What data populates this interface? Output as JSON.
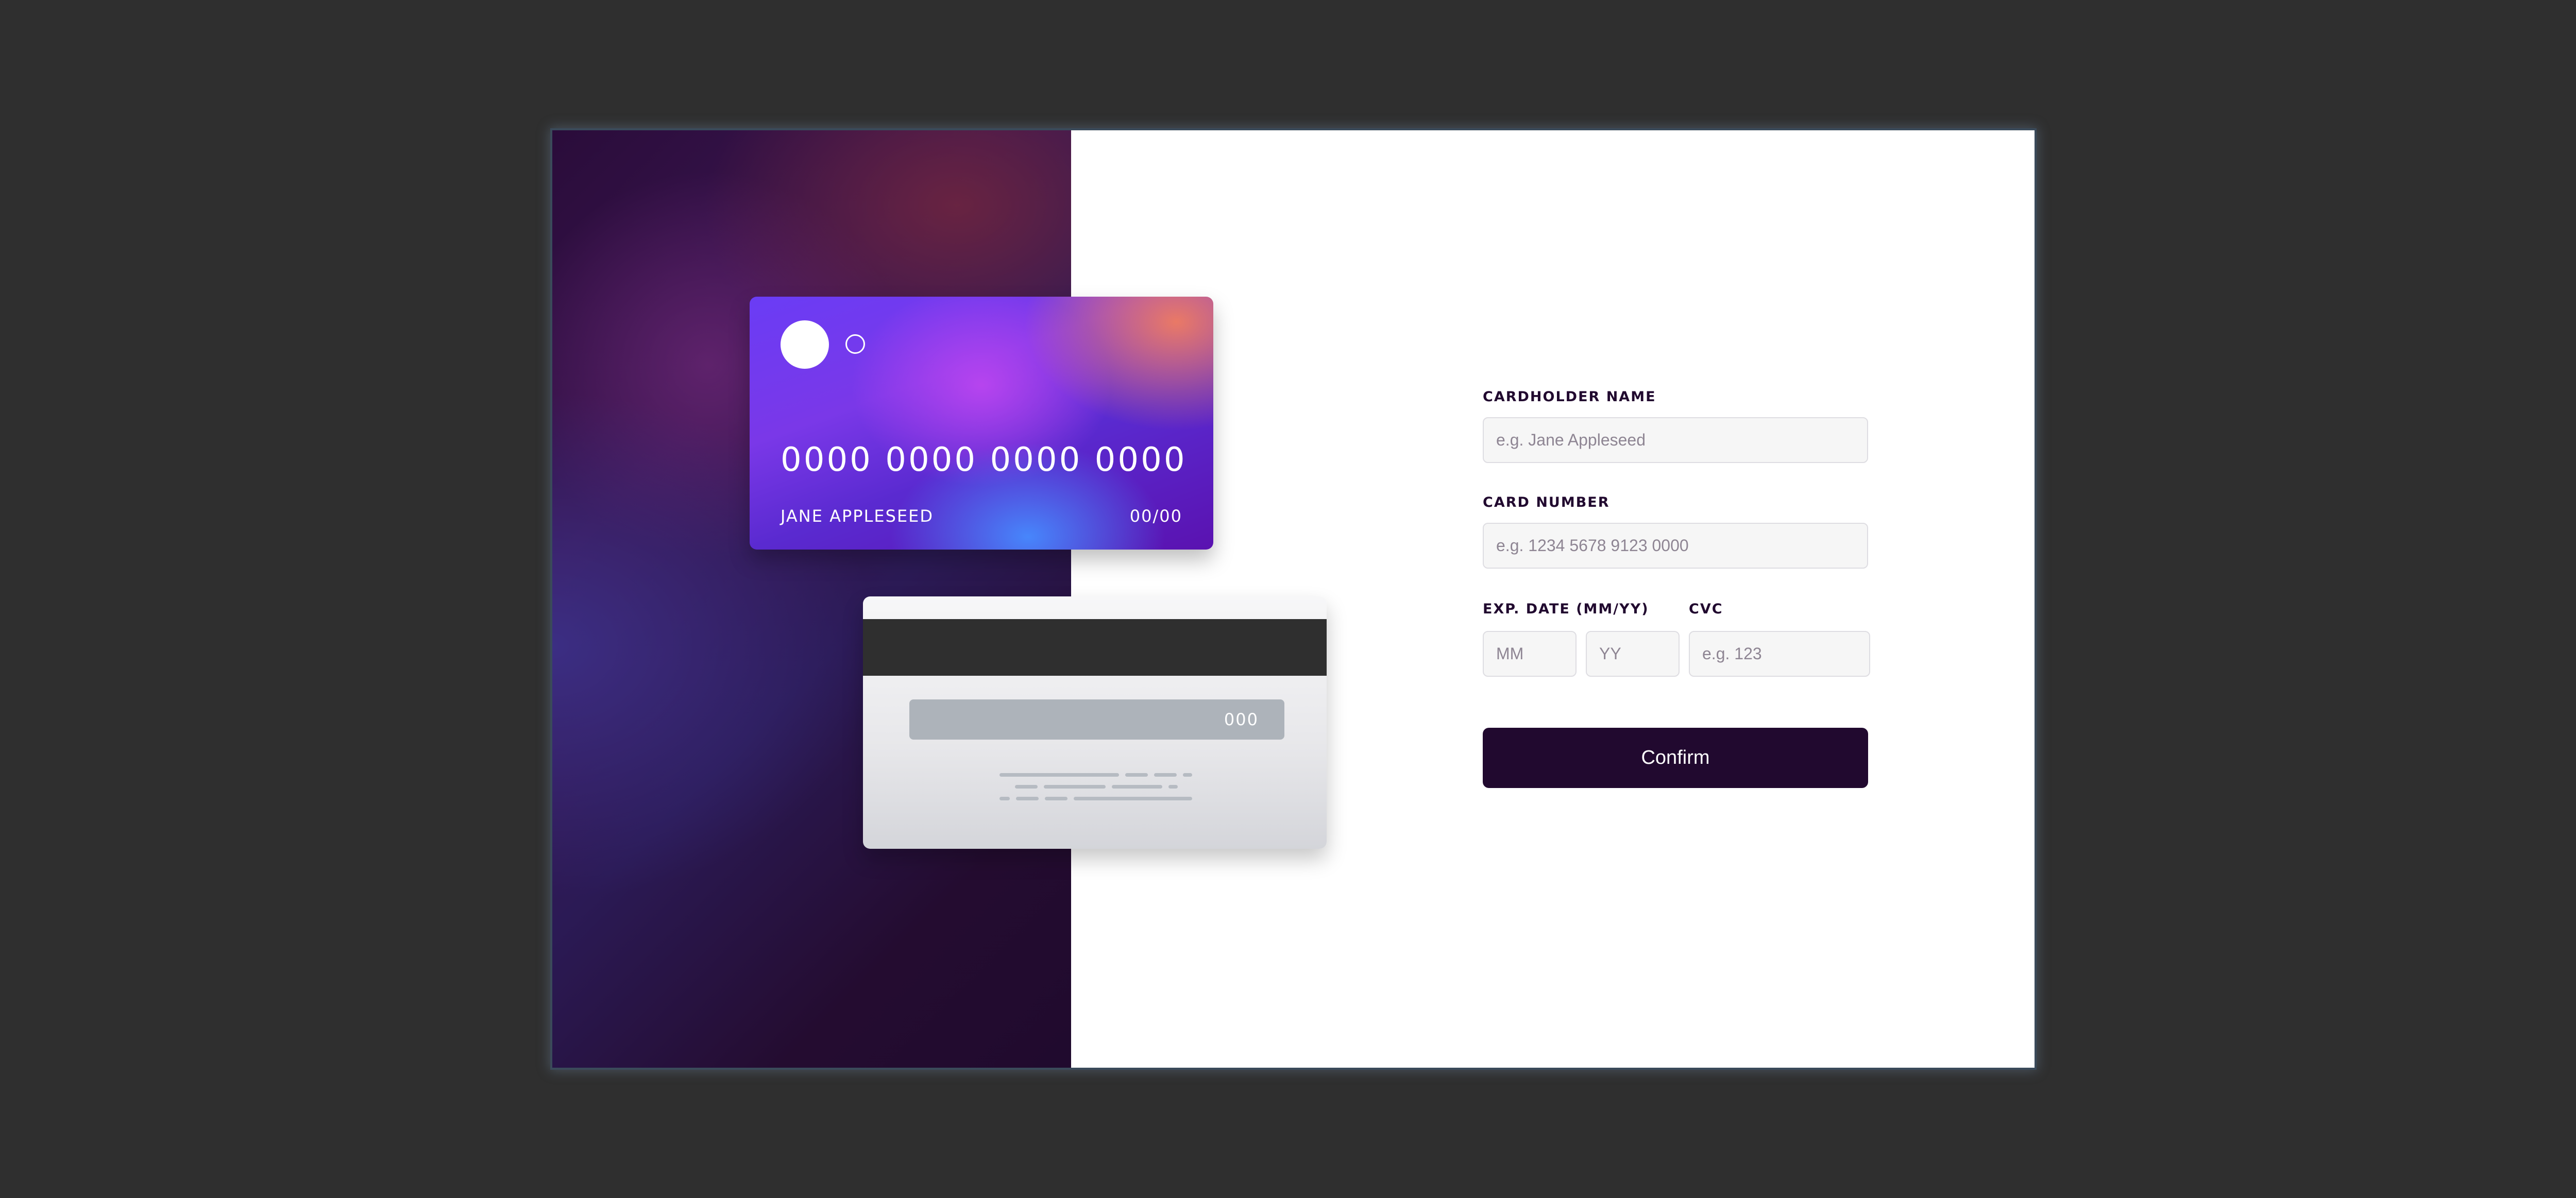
{
  "card_front": {
    "number": "0000 0000 0000 0000",
    "name": "JANE APPLESEED",
    "expiry": "00/00"
  },
  "card_back": {
    "cvc": "000"
  },
  "form": {
    "cardholder_name": {
      "label": "CARDHOLDER NAME",
      "placeholder": "e.g. Jane Appleseed",
      "value": ""
    },
    "card_number": {
      "label": "CARD NUMBER",
      "placeholder": "e.g. 1234 5678 9123 0000",
      "value": ""
    },
    "exp_date": {
      "label": "EXP. DATE (MM/YY)",
      "month_placeholder": "MM",
      "year_placeholder": "YY"
    },
    "cvc": {
      "label": "CVC",
      "placeholder": "e.g. 123",
      "value": ""
    },
    "confirm_label": "Confirm"
  },
  "colors": {
    "page_background": "#2f2f2f",
    "dark_violet": "#21092f",
    "input_border": "#dedde2",
    "placeholder": "#8e8593",
    "card_back_stripe": "#2f2f2f"
  }
}
